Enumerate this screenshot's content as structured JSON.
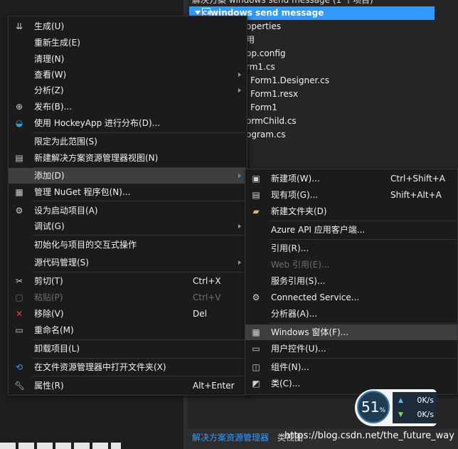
{
  "solution_explorer": {
    "root_text": "解决方案 windows send message (1 个项目)",
    "project_name": "windows send message",
    "items": [
      "operties",
      "用",
      "op.config",
      "rm1.cs",
      "Form1.Designer.cs",
      "Form1.resx",
      "Form1",
      "ormChild.cs",
      "ogram.cs"
    ],
    "tab_solution": "解决方案资源管理器",
    "tab_classview": "类视图",
    "watermark": "https://blog.csdn.net/the_future_way"
  },
  "context_menu": {
    "items": [
      {
        "label": "生成(U)",
        "icon": "build-icon"
      },
      {
        "label": "重新生成(E)"
      },
      {
        "label": "清理(N)"
      },
      {
        "label": "查看(W)",
        "submenu": true
      },
      {
        "label": "分析(Z)",
        "submenu": true
      },
      {
        "label": "发布(B)...",
        "icon": "globe-icon"
      },
      {
        "label": "使用 HockeyApp 进行分布(D)...",
        "icon": "hockeyapp-icon"
      },
      {
        "label": "限定为此范围(S)"
      },
      {
        "label": "新建解决方案资源管理器视图(N)",
        "icon": "new-view-icon"
      },
      {
        "label": "添加(D)",
        "submenu": true,
        "highlighted": true
      },
      {
        "label": "管理 NuGet 程序包(N)...",
        "icon": "nuget-icon"
      },
      {
        "label": "设为启动项目(A)",
        "icon": "gear-icon"
      },
      {
        "label": "调试(G)",
        "submenu": true
      },
      {
        "label": "初始化与项目的交互式操作"
      },
      {
        "label": "源代码管理(S)",
        "submenu": true
      },
      {
        "label": "剪切(T)",
        "shortcut": "Ctrl+X",
        "icon": "scissors-icon"
      },
      {
        "label": "粘贴(P)",
        "shortcut": "Ctrl+V",
        "disabled": true,
        "icon": "paste-icon"
      },
      {
        "label": "移除(V)",
        "shortcut": "Del",
        "icon": "remove-icon"
      },
      {
        "label": "重命名(M)",
        "icon": "rename-icon"
      },
      {
        "label": "卸载项目(L)"
      },
      {
        "label": "在文件资源管理器中打开文件夹(X)",
        "icon": "refresh-icon"
      },
      {
        "label": "属性(R)",
        "shortcut": "Alt+Enter",
        "icon": "wrench-icon"
      }
    ]
  },
  "add_submenu": {
    "items": [
      {
        "label": "新建项(W)...",
        "shortcut": "Ctrl+Shift+A",
        "icon": "new-item-icon"
      },
      {
        "label": "现有项(G)...",
        "shortcut": "Shift+Alt+A",
        "icon": "existing-item-icon"
      },
      {
        "label": "新建文件夹(D)",
        "icon": "new-folder-icon"
      },
      {
        "label": "Azure API 应用客户端..."
      },
      {
        "label": "引用(R)..."
      },
      {
        "label": "Web 引用(E)...",
        "disabled": true
      },
      {
        "label": "服务引用(S)..."
      },
      {
        "label": "Connected Service...",
        "icon": "connected-service-icon"
      },
      {
        "label": "分析器(A)..."
      },
      {
        "label": "Windows 窗体(F)...",
        "highlighted": true,
        "icon": "windows-form-icon"
      },
      {
        "label": "用户控件(U)...",
        "icon": "user-control-icon"
      },
      {
        "label": "组件(N)...",
        "icon": "component-icon"
      },
      {
        "label": "类(C)...",
        "icon": "class-icon"
      }
    ]
  },
  "perf_widget": {
    "cpu_percent": "51",
    "percent_sign": "%",
    "upload": "0K/s",
    "download": "0K/s"
  }
}
